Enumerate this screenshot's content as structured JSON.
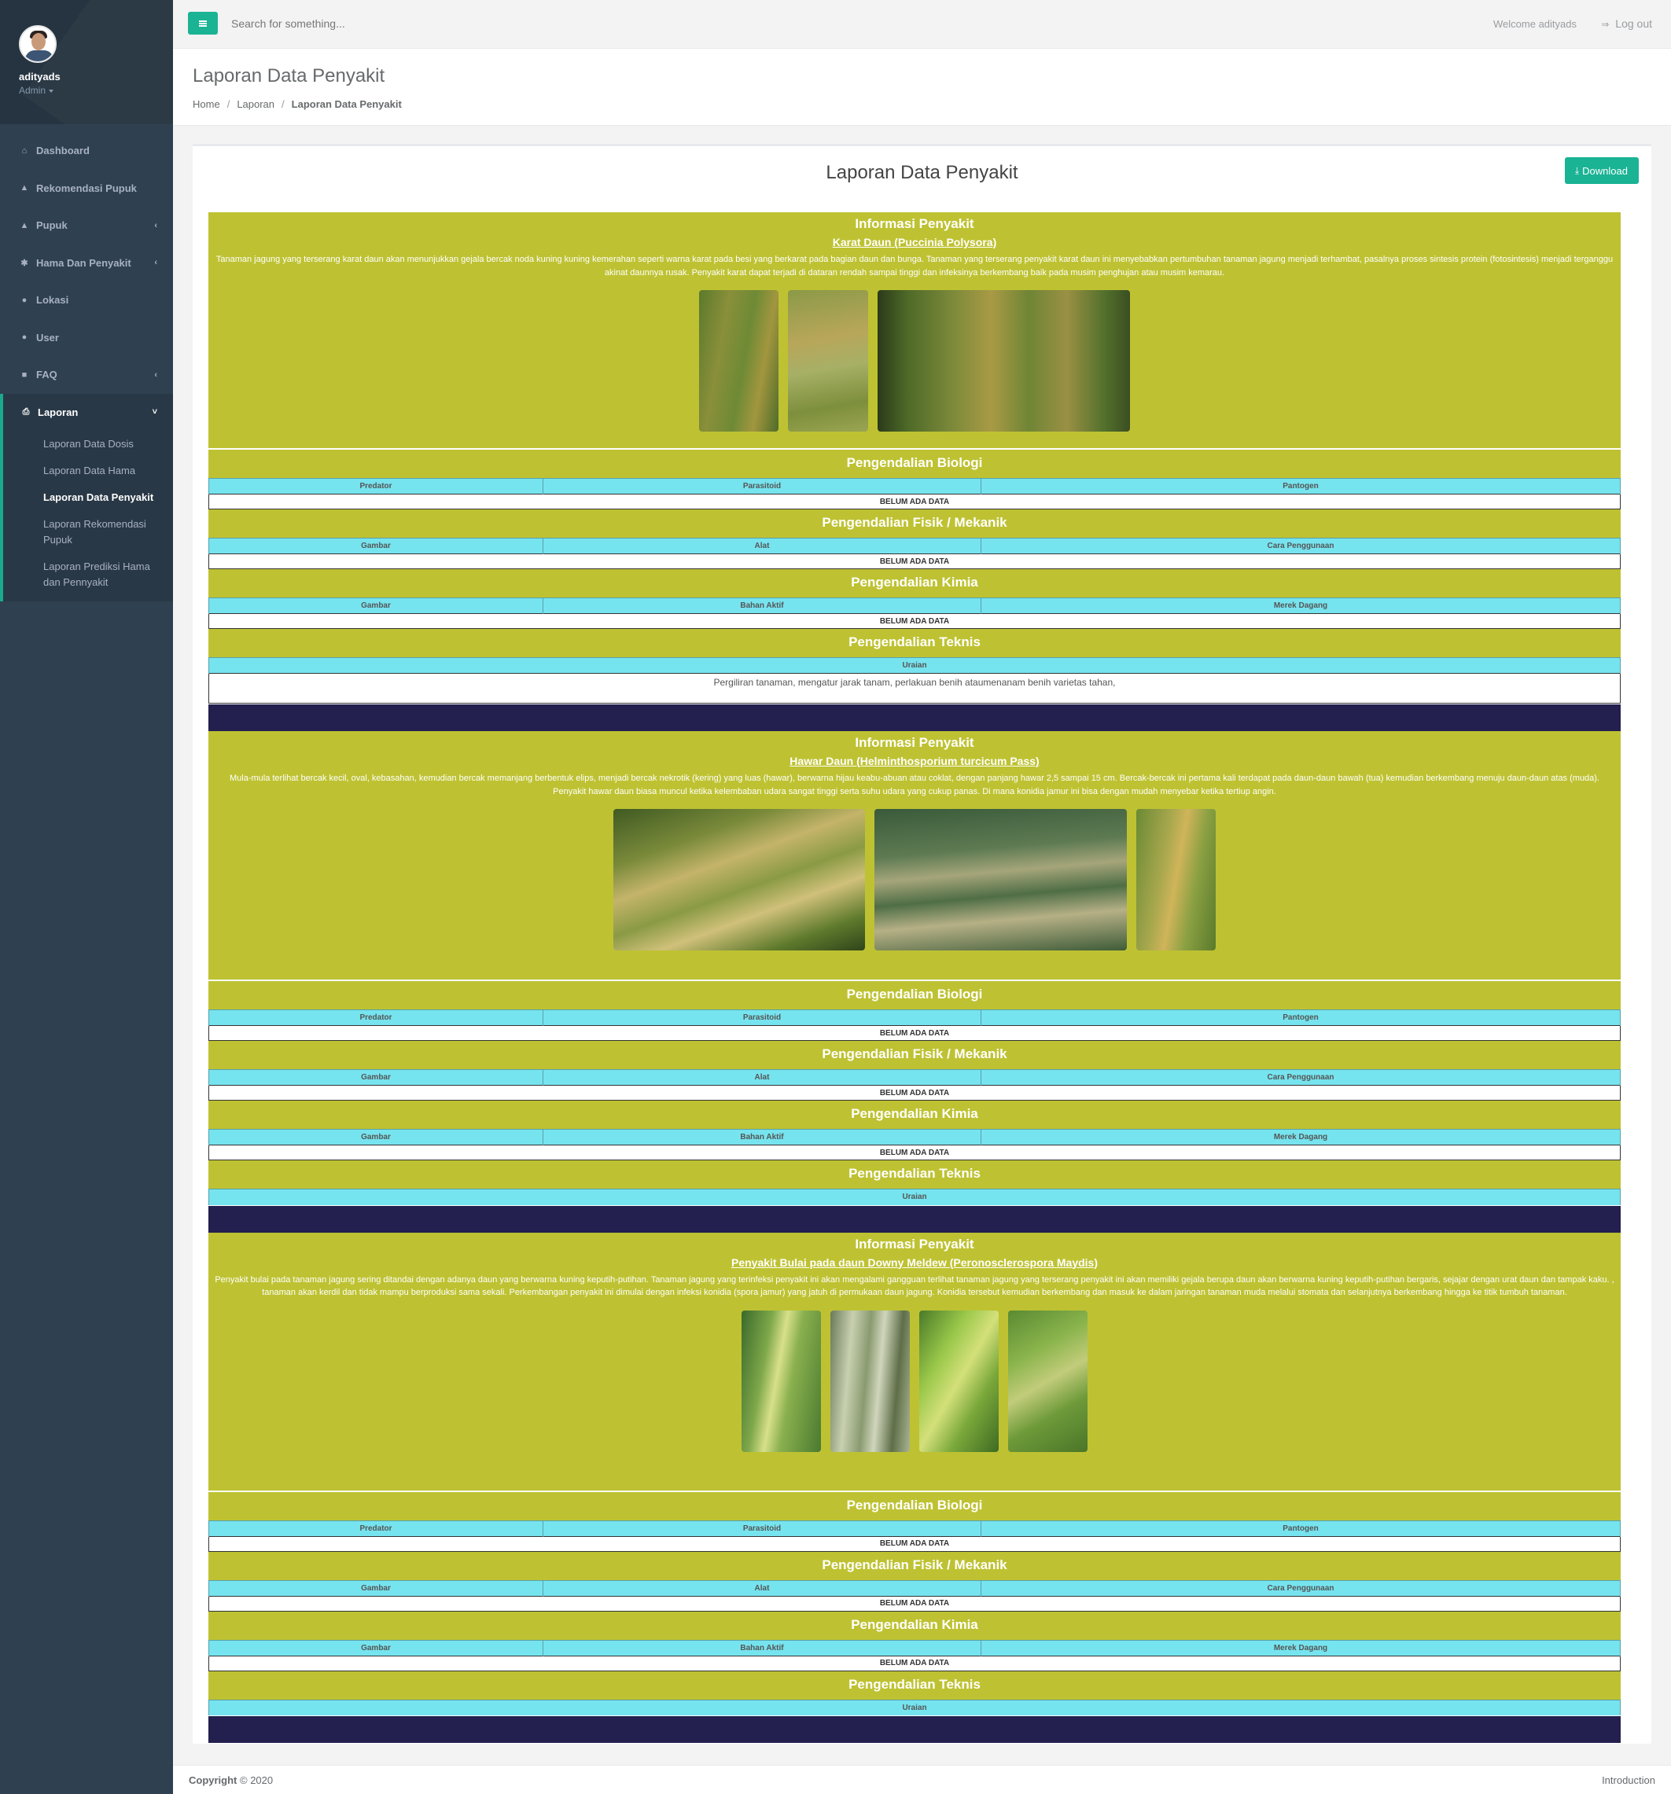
{
  "user": {
    "name": "adityads",
    "role": "Admin"
  },
  "sidebar": {
    "items": [
      {
        "label": "Dashboard",
        "icon": "home-icon"
      },
      {
        "label": "Rekomendasi Pupuk",
        "icon": "thumbs-up-icon"
      },
      {
        "label": "Pupuk",
        "icon": "tree-icon"
      },
      {
        "label": "Hama Dan Penyakit",
        "icon": "bug-icon"
      },
      {
        "label": "Lokasi",
        "icon": "map-marker-icon"
      },
      {
        "label": "User",
        "icon": "user-icon"
      },
      {
        "label": "FAQ",
        "icon": "comments-icon"
      }
    ],
    "active": {
      "label": "Laporan",
      "icon": "print-icon"
    },
    "subitems": [
      "Laporan Data Dosis",
      "Laporan Data Hama",
      "Laporan Data Penyakit",
      "Laporan Rekomendasi Pupuk",
      "Laporan Prediksi Hama dan Pennyakit"
    ]
  },
  "topbar": {
    "search_placeholder": "Search for something...",
    "welcome": "Welcome adityads",
    "logout": "Log out"
  },
  "page": {
    "title": "Laporan Data Penyakit",
    "breadcrumb": [
      "Home",
      "Laporan",
      "Laporan Data Penyakit"
    ]
  },
  "panel": {
    "title": "Laporan Data Penyakit",
    "download": "Download"
  },
  "labels": {
    "info": "Informasi Penyakit",
    "biologi": "Pengendalian Biologi",
    "fisik": "Pengendalian Fisik / Mekanik",
    "kimia": "Pengendalian Kimia",
    "teknis": "Pengendalian Teknis",
    "no_data": "BELUM ADA DATA",
    "cols_biologi": [
      "Predator",
      "Parasitoid",
      "Pantogen"
    ],
    "cols_fisik": [
      "Gambar",
      "Alat",
      "Cara Penggunaan"
    ],
    "cols_kimia": [
      "Gambar",
      "Bahan Aktif",
      "Merek Dagang"
    ],
    "col_uraian": "Uraian"
  },
  "diseases": [
    {
      "name": "Karat Daun (Puccinia Polysora)",
      "description": "Tanaman jagung yang terserang karat daun akan menunjukkan gejala bercak noda kuning kuning kemerahan seperti warna karat pada besi yang berkarat pada bagian daun dan bunga. Tanaman yang terserang penyakit karat daun ini menyebabkan pertumbuhan tanaman jagung menjadi terhambat, pasalnya proses sintesis protein (fotosintesis) menjadi terganggu akinat daunnya rusak. Penyakit karat dapat terjadi di dataran rendah sampai tinggi dan infeksinya berkembang baik pada musim penghujan atau musim kemarau.",
      "uraian": "Pergiliran tanaman, mengatur jarak tanam, perlakuan benih ataumenanam benih varietas tahan,"
    },
    {
      "name": "Hawar Daun (Helminthosporium turcicum Pass)",
      "description": "Mula-mula terlihat bercak kecil, oval, kebasahan, kemudian bercak memanjang berbentuk elips, menjadi bercak nekrotik (kering) yang luas (hawar), berwarna hijau keabu-abuan atau coklat, dengan panjang hawar 2,5 sampai 15 cm. Bercak-bercak ini pertama kali terdapat pada daun-daun bawah (tua) kemudian berkembang menuju daun-daun atas (muda). Penyakit hawar daun biasa muncul ketika kelembaban udara sangat tinggi serta suhu udara yang cukup panas. Di mana konidia jamur ini bisa dengan mudah menyebar ketika tertiup angin.",
      "uraian": ""
    },
    {
      "name": "Penyakit Bulai pada daun Downy Meldew (Peronosclerospora Maydis)",
      "description": "Penyakit bulai pada tanaman jagung sering ditandai dengan adanya daun yang berwarna kuning keputih-putihan. Tanaman jagung yang terinfeksi penyakit ini akan mengalami gangguan terlihat tanaman jagung yang terserang penyakit ini akan memiliki gejala berupa daun akan berwarna kuning keputih-putihan bergaris, sejajar dengan urat daun dan tampak kaku. , tanaman akan kerdil dan tidak mampu berproduksi sama sekali. Perkembangan penyakit ini dimulai dengan infeksi konidia (spora jamur) yang jatuh di permukaan daun jagung. Konidia tersebut kemudian berkembang dan masuk ke dalam jaringan tanaman muda melalui stomata dan selanjutnya berkembang hingga ke titik tumbuh tanaman.",
      "uraian": ""
    }
  ],
  "footer": {
    "copyright": "Copyright",
    "year": "© 2020",
    "right": "Introduction"
  },
  "colors": {
    "accent": "#1ab394",
    "section": "#bec232",
    "table_header": "#76e4ef",
    "divider": "#23204f",
    "sidebar": "#2f4050"
  }
}
